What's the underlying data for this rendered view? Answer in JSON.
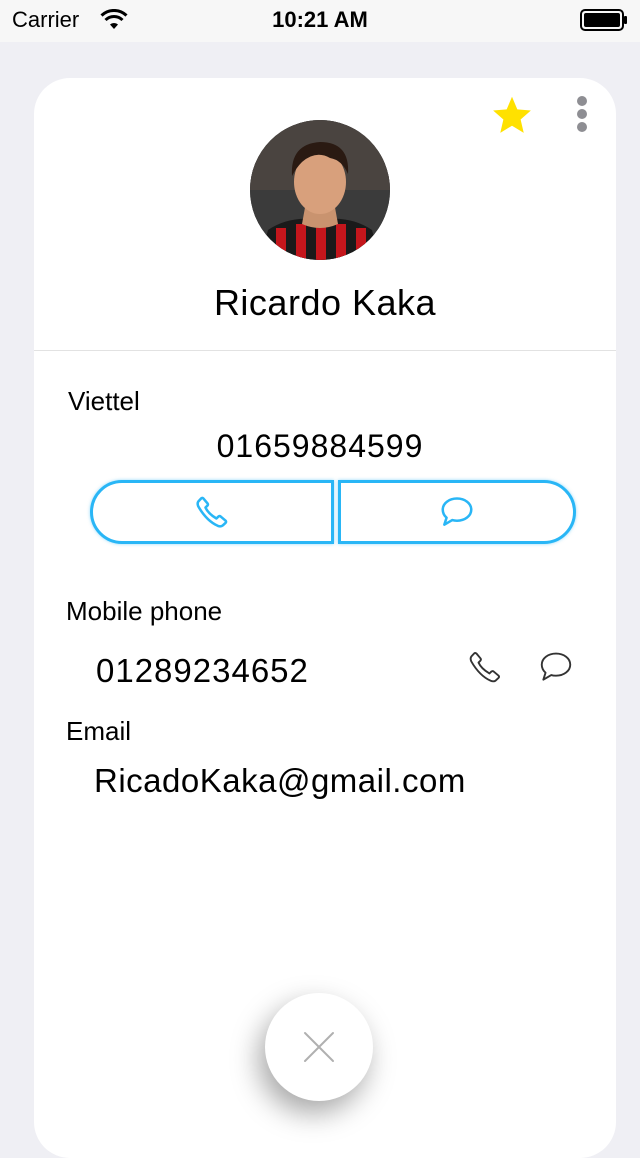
{
  "status_bar": {
    "carrier": "Carrier",
    "time": "10:21 AM"
  },
  "contact": {
    "name": "Ricardo Kaka",
    "favorite": true,
    "phones": [
      {
        "label": "Viettel",
        "number": "01659884599"
      },
      {
        "label": "Mobile phone",
        "number": "01289234652"
      }
    ],
    "email_label": "Email",
    "email": "RicadoKaka@gmail.com"
  },
  "colors": {
    "accent": "#29b6f6",
    "star": "#ffe100",
    "background": "#efeff4",
    "card": "#ffffff"
  },
  "icons": {
    "favorite": "star-icon",
    "more": "more-vertical-icon",
    "call": "phone-icon",
    "message": "chat-bubble-icon",
    "close": "close-icon"
  }
}
